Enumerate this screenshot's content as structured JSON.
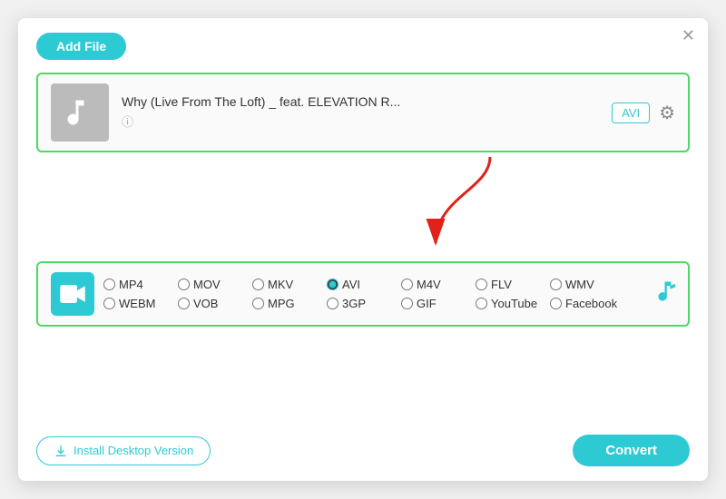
{
  "dialog": {
    "close_label": "✕",
    "add_file_label": "Add File",
    "file": {
      "name": "Why (Live From The Loft) _ feat. ELEVATION R...",
      "format_badge": "AVI"
    },
    "formats_row1": [
      "MP4",
      "MOV",
      "MKV",
      "AVI",
      "M4V",
      "FLV",
      "WMV"
    ],
    "formats_row2": [
      "WEBM",
      "VOB",
      "MPG",
      "3GP",
      "GIF",
      "YouTube",
      "Facebook"
    ],
    "selected_format": "AVI",
    "bottom": {
      "install_label": "Install Desktop Version",
      "convert_label": "Convert"
    }
  }
}
